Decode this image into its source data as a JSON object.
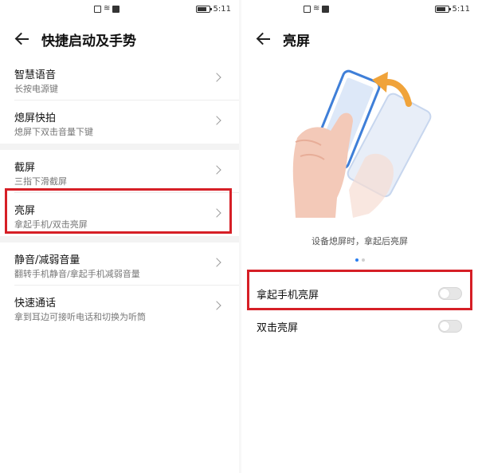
{
  "status_bar": {
    "time": "5:11"
  },
  "left": {
    "title": "快捷启动及手势",
    "groups": [
      [
        {
          "title": "智慧语音",
          "subtitle": "长按电源键"
        },
        {
          "title": "熄屏快拍",
          "subtitle": "熄屏下双击音量下键"
        }
      ],
      [
        {
          "title": "截屏",
          "subtitle": "三指下滑截屏"
        },
        {
          "title": "亮屏",
          "subtitle": "拿起手机/双击亮屏"
        }
      ],
      [
        {
          "title": "静音/减弱音量",
          "subtitle": "翻转手机静音/拿起手机减弱音量"
        },
        {
          "title": "快速通话",
          "subtitle": "拿到耳边可接听电话和切换为听筒"
        }
      ]
    ]
  },
  "right": {
    "title": "亮屏",
    "caption": "设备熄屏时，拿起后亮屏",
    "page_indicator": {
      "current": 1,
      "total": 2
    },
    "toggles": [
      {
        "label": "拿起手机亮屏",
        "on": false
      },
      {
        "label": "双击亮屏",
        "on": false
      }
    ]
  },
  "colors": {
    "highlight": "#d61f26",
    "accent": "#2a7ff0",
    "arrow": "#f0a33a",
    "phone_outline": "#3f7fd8"
  }
}
